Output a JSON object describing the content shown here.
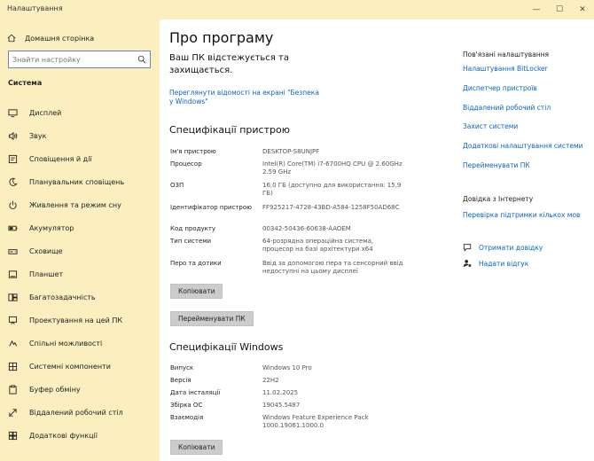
{
  "window": {
    "title": "Налаштування",
    "controls": [
      "—",
      "☐",
      "✕"
    ]
  },
  "sidebar": {
    "home": "Домашня сторінка",
    "search_placeholder": "Знайти настройку",
    "section": "Система",
    "items": [
      {
        "label": "Дисплей",
        "icon": "display-icon"
      },
      {
        "label": "Звук",
        "icon": "sound-icon"
      },
      {
        "label": "Сповіщення й дії",
        "icon": "notifications-icon"
      },
      {
        "label": "Планувальник сповіщень",
        "icon": "moon-icon"
      },
      {
        "label": "Живлення та режим сну",
        "icon": "power-icon"
      },
      {
        "label": "Акумулятор",
        "icon": "battery-icon"
      },
      {
        "label": "Сховище",
        "icon": "storage-icon"
      },
      {
        "label": "Планшет",
        "icon": "tablet-icon"
      },
      {
        "label": "Багатозадачність",
        "icon": "multitasking-icon"
      },
      {
        "label": "Проектування на цей ПК",
        "icon": "projecting-icon"
      },
      {
        "label": "Спільні можливості",
        "icon": "shared-experiences-icon"
      },
      {
        "label": "Системні компоненти",
        "icon": "components-icon"
      },
      {
        "label": "Буфер обміну",
        "icon": "clipboard-icon"
      },
      {
        "label": "Віддалений робочий стіл",
        "icon": "remote-desktop-icon"
      },
      {
        "label": "Додаткові функції",
        "icon": "optional-features-icon"
      }
    ]
  },
  "main": {
    "title": "Про програму",
    "protection": "Ваш ПК відстежується та захищається.",
    "security_link": "Переглянути відомості на екрані \"Безпека у Windows\"",
    "device_heading": "Специфікації пристрою",
    "device_specs": [
      {
        "key": "Ім'я пристрою",
        "value": "DESKTOP-S8UNJPF"
      },
      {
        "key": "Процесор",
        "value": "Intel(R) Core(TM) i7-6700HQ CPU @ 2.60GHz   2.59 GHz"
      },
      {
        "key": "ОЗП",
        "value": "16,0 ГБ (доступно для використання: 15,9 ГБ)"
      },
      {
        "key": "Ідентифікатор пристрою",
        "value": "FF925217-4728-43BD-A584-1258F50AD68C"
      },
      {
        "key": "Код продукту",
        "value": "00342-50436-60638-AAOEM"
      },
      {
        "key": "Тип системи",
        "value": "64-розрядна операційна система, процесор на базі архітектури x64"
      },
      {
        "key": "Перо та дотики",
        "value": "Ввід за допомогою пера та сенсорний ввід недоступні на цьому дисплеї"
      }
    ],
    "copy_button": "Копіювати",
    "rename_button": "Перейменувати ПК",
    "windows_heading": "Специфікації Windows",
    "windows_specs": [
      {
        "key": "Випуск",
        "value": "Windows 10 Pro"
      },
      {
        "key": "Версія",
        "value": "22H2"
      },
      {
        "key": "Дата інсталяції",
        "value": "11.02.2025"
      },
      {
        "key": "Збірка ОС",
        "value": "19045.5487"
      },
      {
        "key": "Взаємодія",
        "value": "Windows Feature Experience Pack 1000.19061.1000.0"
      }
    ],
    "copy_button_2": "Копіювати"
  },
  "related": {
    "heading": "Пов'язані налаштування",
    "links": [
      "Налаштування BitLocker",
      "Диспетчер пристроїв",
      "Віддалений робочий стіл",
      "Захист системи",
      "Додаткові налаштування системи",
      "Перейменувати ПК"
    ],
    "help_heading": "Довідка з Інтернету",
    "help_link": "Перевірка підтримки кількох мов",
    "get_help": "Отримати довідку",
    "feedback": "Надати відгук"
  },
  "colors": {
    "sidebar_bg": "#fbefc0",
    "link": "#0a64c2",
    "button_bg": "#cccccc"
  }
}
